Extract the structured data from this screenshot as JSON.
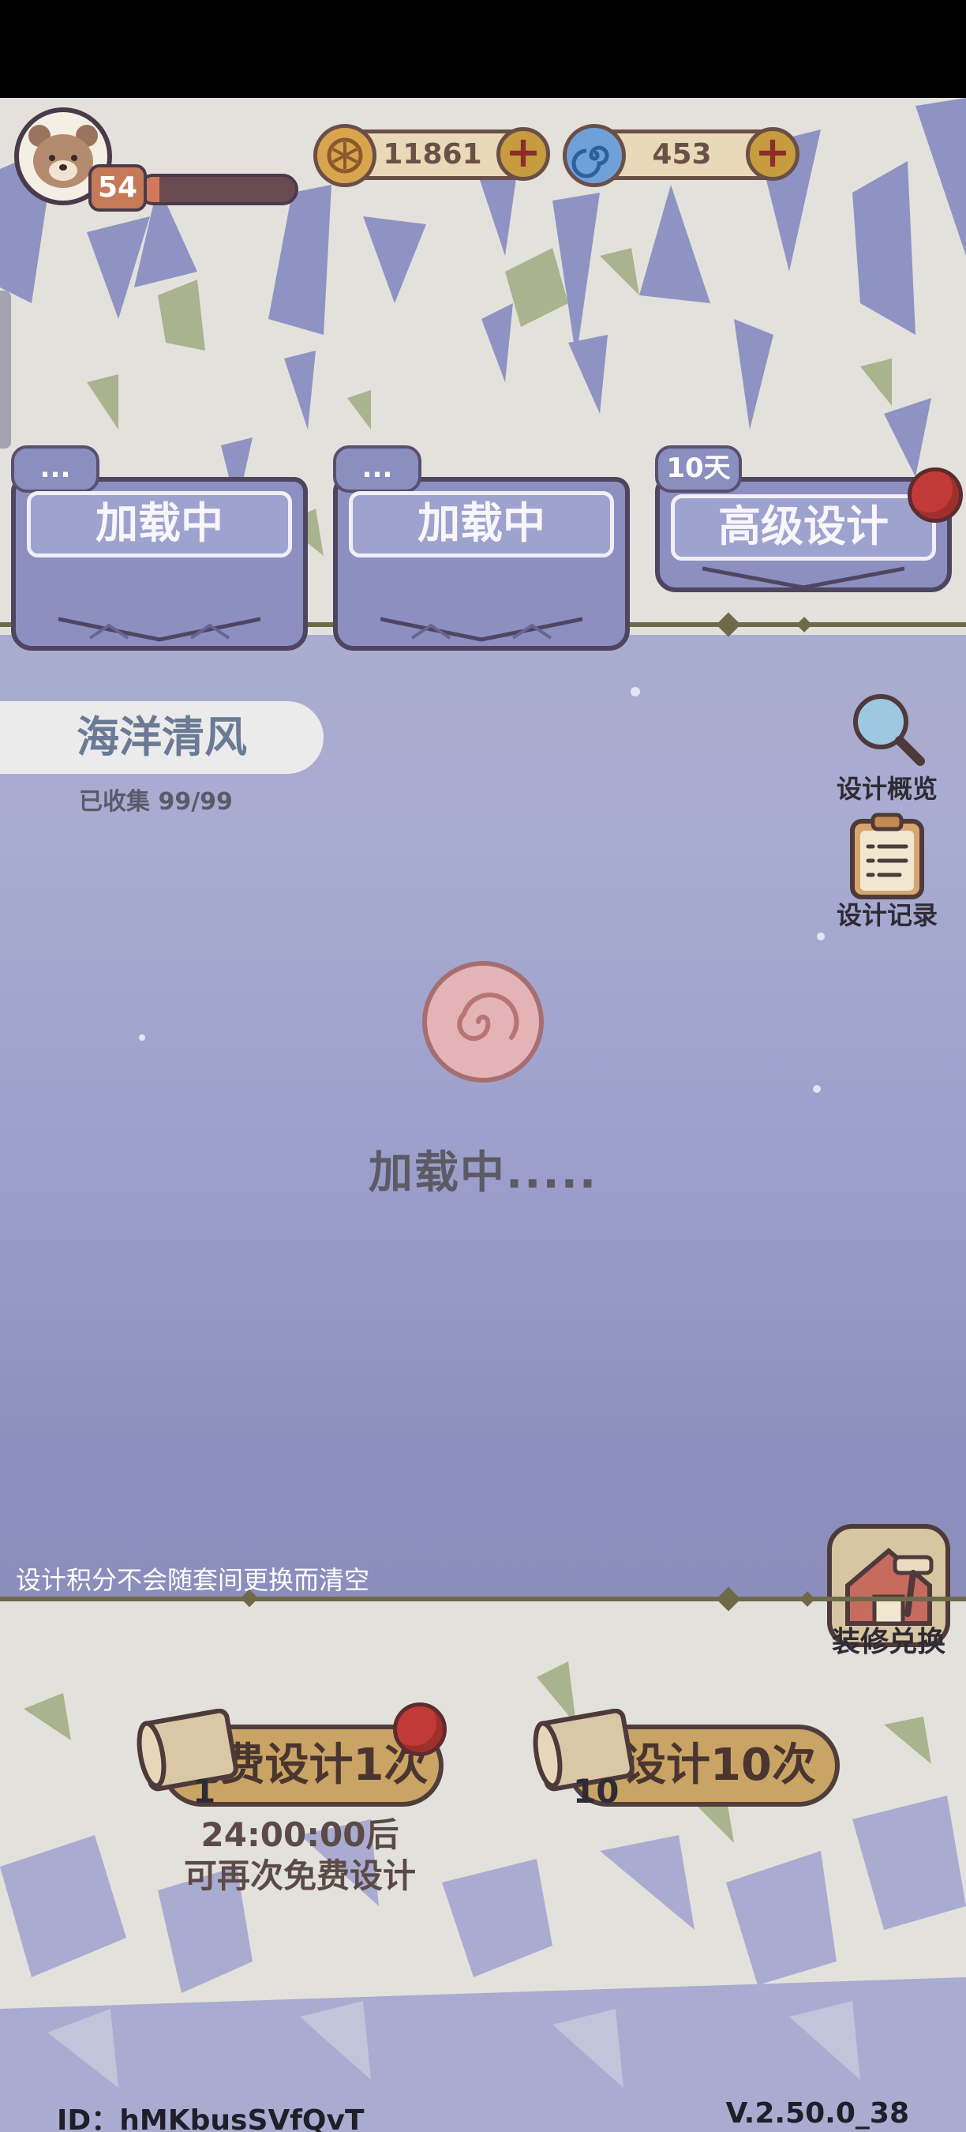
{
  "header": {
    "level": "54",
    "xp_progress": 0.12,
    "coins": "11861",
    "gems": "453"
  },
  "pockets": [
    {
      "tag": "...",
      "label": "加载中"
    },
    {
      "tag": "...",
      "label": "加载中"
    },
    {
      "tag": "10天",
      "label": "高级设计"
    }
  ],
  "collection": {
    "title": "海洋清风",
    "count": "已收集 99/99"
  },
  "side_buttons": {
    "overview": "设计概览",
    "records": "设计记录",
    "renovation": "装修兑换"
  },
  "loading_text": "加载中.....",
  "tip": "设计积分不会随套间更换而清空",
  "draw": {
    "free_label": "免费设计1次",
    "free_count": "1",
    "ten_label": "设计10次",
    "ten_count": "10",
    "timer_line1": "24:00:00后",
    "timer_line2": "可再次免费设计"
  },
  "footer": {
    "id": "ID：hMKbusSVfQvT",
    "version": "V.2.50.0_38"
  },
  "colors": {
    "accent_gold": "#c9a464",
    "badge_red": "#c23a37",
    "panel_purple": "#8c8fc0"
  }
}
